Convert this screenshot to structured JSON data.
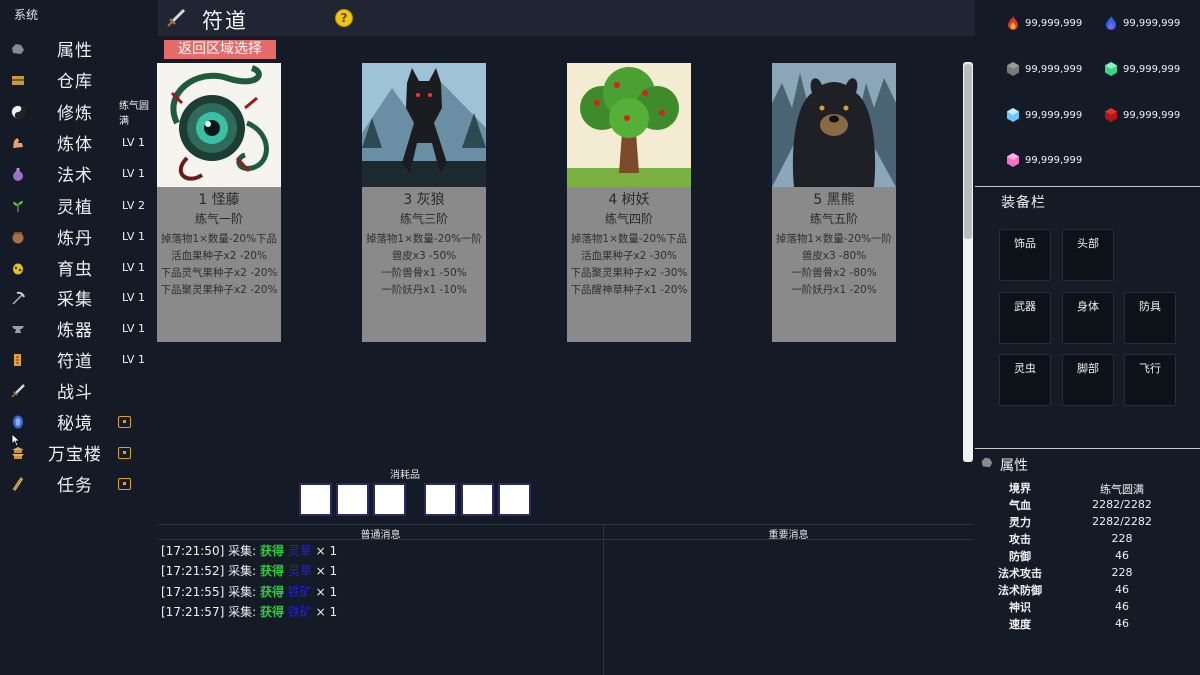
{
  "system_label": "系统",
  "sidebar": {
    "items": [
      {
        "label": "属性",
        "level": "",
        "locked": false
      },
      {
        "label": "仓库",
        "level": "",
        "locked": false
      },
      {
        "label": "修炼",
        "level": "练气圆满",
        "locked": false
      },
      {
        "label": "炼体",
        "level": "LV 1",
        "locked": false
      },
      {
        "label": "法术",
        "level": "LV 1",
        "locked": false
      },
      {
        "label": "灵植",
        "level": "LV 2",
        "locked": false
      },
      {
        "label": "炼丹",
        "level": "LV 1",
        "locked": false
      },
      {
        "label": "育虫",
        "level": "LV 1",
        "locked": false
      },
      {
        "label": "采集",
        "level": "LV 1",
        "locked": false
      },
      {
        "label": "炼器",
        "level": "LV 1",
        "locked": false
      },
      {
        "label": "符道",
        "level": "LV 1",
        "locked": false
      },
      {
        "label": "战斗",
        "level": "",
        "locked": false
      },
      {
        "label": "秘境",
        "level": "",
        "locked": true
      },
      {
        "label": "万宝楼",
        "level": "",
        "locked": true
      },
      {
        "label": "任务",
        "level": "",
        "locked": true
      }
    ]
  },
  "header": {
    "title": "符道",
    "help": "?"
  },
  "back_button": "返回区域选择",
  "monsters": [
    {
      "name": "1 怪藤",
      "tier": "练气一阶",
      "drops": [
        "掉落物1×数量-20%下品",
        "活血果种子x2 -20%",
        "下品灵气果种子x2 -20%",
        "下品聚灵果种子x2 -20%"
      ]
    },
    {
      "name": "3 灰狼",
      "tier": "练气三阶",
      "drops": [
        "掉落物1×数量-20%一阶",
        "兽皮x3 -50%",
        "一阶兽骨x1 -50%",
        "一阶妖丹x1 -10%"
      ]
    },
    {
      "name": "4 树妖",
      "tier": "练气四阶",
      "drops": [
        "掉落物1×数量-20%下品",
        "活血果种子x2 -30%",
        "下品聚灵果种子x2 -30%",
        "下品醒神草种子x1 -20%"
      ]
    },
    {
      "name": "5 黑熊",
      "tier": "练气五阶",
      "drops": [
        "掉落物1×数量-20%一阶",
        "兽皮x3 -80%",
        "一阶兽骨x2 -80%",
        "一阶妖丹x1 -20%"
      ]
    }
  ],
  "consumables_label": "消耗品",
  "messages": {
    "normal_header": "普通消息",
    "important_header": "重要消息",
    "log": [
      {
        "time": "[17:21:50]",
        "action": "采集:",
        "gain": "获得",
        "item": "灵草",
        "qty": "× 1"
      },
      {
        "time": "[17:21:52]",
        "action": "采集:",
        "gain": "获得",
        "item": "灵草",
        "qty": "× 1"
      },
      {
        "time": "[17:21:55]",
        "action": "采集:",
        "gain": "获得",
        "item": "铁矿",
        "qty": "× 1"
      },
      {
        "time": "[17:21:57]",
        "action": "采集:",
        "gain": "获得",
        "item": "铁矿",
        "qty": "× 1"
      }
    ]
  },
  "resources": [
    {
      "icon": "fire-gem-icon",
      "value": "99,999,999",
      "color": "#e8332a"
    },
    {
      "icon": "water-gem-icon",
      "value": "99,999,999",
      "color": "#2a6ae8"
    },
    {
      "icon": "stone-gem-icon",
      "value": "99,999,999",
      "color": "#7a7a7a"
    },
    {
      "icon": "jade-gem-icon",
      "value": "99,999,999",
      "color": "#3cd48a"
    },
    {
      "icon": "ice-gem-icon",
      "value": "99,999,999",
      "color": "#6ec8f5"
    },
    {
      "icon": "blood-gem-icon",
      "value": "99,999,999",
      "color": "#b31414"
    },
    {
      "icon": "pink-gem-icon",
      "value": "99,999,999",
      "color": "#f070c8"
    }
  ],
  "equipment": {
    "title": "装备栏",
    "slots": [
      "饰品",
      "头部",
      "武器",
      "身体",
      "防具",
      "灵虫",
      "脚部",
      "飞行"
    ]
  },
  "attributes": {
    "title": "属性",
    "stats": [
      {
        "name": "境界",
        "value": "练气圆满"
      },
      {
        "name": "气血",
        "value": "2282/2282"
      },
      {
        "name": "灵力",
        "value": "2282/2282"
      },
      {
        "name": "攻击",
        "value": "228"
      },
      {
        "name": "防御",
        "value": "46"
      },
      {
        "name": "法术攻击",
        "value": "228"
      },
      {
        "name": "法术防御",
        "value": "46"
      },
      {
        "name": "神识",
        "value": "46"
      },
      {
        "name": "速度",
        "value": "46"
      }
    ]
  }
}
